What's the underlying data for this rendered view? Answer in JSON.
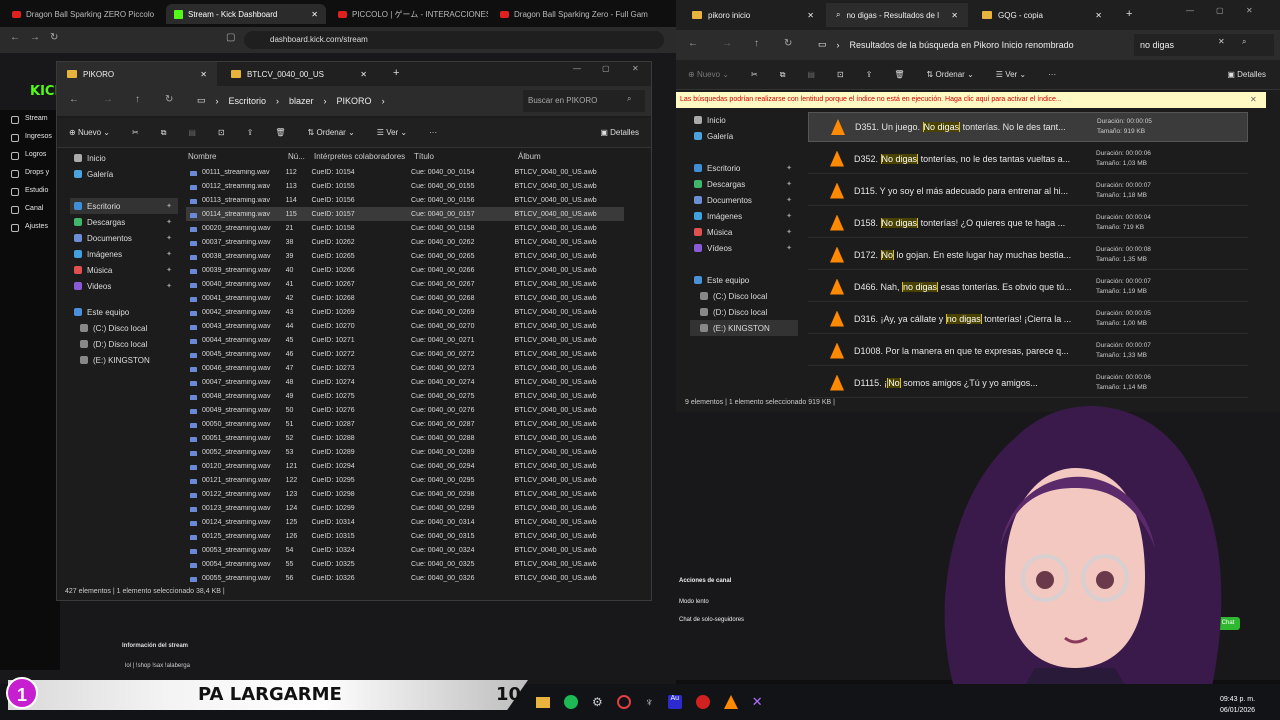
{
  "browser": {
    "tabs": [
      "Dragon Ball Sparking ZERO Piccolo",
      "Stream - Kick Dashboard",
      "PICCOLO | ゲーム - INTERACCIONES E",
      "Dragon Ball Sparking Zero - Full Gam"
    ],
    "url": "dashboard.kick.com/stream"
  },
  "kick": {
    "logo": "KICK",
    "sidebar": [
      "Stream",
      "Ingresos",
      "Logros",
      "Drops y",
      "Estudio",
      "Canal",
      "Ajustes"
    ],
    "stream_info": "Información del stream",
    "stream_title": "lol | !shop !sax !alaberga",
    "category": "Conversando",
    "channel_actions": "Acciones de canal",
    "slow_mode": "Modo lento",
    "followers_chat": "Chat de solo-seguidores",
    "chat_btn": "Chat"
  },
  "explorer1": {
    "tabs": [
      "PIKORO",
      "BTLCV_0040_00_US"
    ],
    "crumbs": [
      "Escritorio",
      "blazer",
      "PIKORO"
    ],
    "search": "Buscar en PIKORO",
    "toolbar": {
      "new": "Nuevo",
      "sort": "Ordenar",
      "view": "Ver",
      "details": "Detalles"
    },
    "nav": [
      "Inicio",
      "Galería",
      "Escritorio",
      "Descargas",
      "Documentos",
      "Imágenes",
      "Música",
      "Videos",
      "Este equipo",
      "(C:) Disco local",
      "(D:) Disco local",
      "(E:) KINGSTON"
    ],
    "columns": [
      "Nombre",
      "Nú...",
      "Intérpretes colaboradores",
      "Título",
      "Álbum"
    ],
    "rows": [
      [
        "00111_streaming.wav",
        "112",
        "CueID: 10154",
        "Cue: 0040_00_0154",
        "BTLCV_0040_00_US.awb"
      ],
      [
        "00112_streaming.wav",
        "113",
        "CueID: 10155",
        "Cue: 0040_00_0155",
        "BTLCV_0040_00_US.awb"
      ],
      [
        "00113_streaming.wav",
        "114",
        "CueID: 10156",
        "Cue: 0040_00_0156",
        "BTLCV_0040_00_US.awb"
      ],
      [
        "00114_streaming.wav",
        "115",
        "CueID: 10157",
        "Cue: 0040_00_0157",
        "BTLCV_0040_00_US.awb"
      ],
      [
        "00020_streaming.wav",
        "21",
        "CueID: 10158",
        "Cue: 0040_00_0158",
        "BTLCV_0040_00_US.awb"
      ],
      [
        "00037_streaming.wav",
        "38",
        "CueID: 10262",
        "Cue: 0040_00_0262",
        "BTLCV_0040_00_US.awb"
      ],
      [
        "00038_streaming.wav",
        "39",
        "CueID: 10265",
        "Cue: 0040_00_0265",
        "BTLCV_0040_00_US.awb"
      ],
      [
        "00039_streaming.wav",
        "40",
        "CueID: 10266",
        "Cue: 0040_00_0266",
        "BTLCV_0040_00_US.awb"
      ],
      [
        "00040_streaming.wav",
        "41",
        "CueID: 10267",
        "Cue: 0040_00_0267",
        "BTLCV_0040_00_US.awb"
      ],
      [
        "00041_streaming.wav",
        "42",
        "CueID: 10268",
        "Cue: 0040_00_0268",
        "BTLCV_0040_00_US.awb"
      ],
      [
        "00042_streaming.wav",
        "43",
        "CueID: 10269",
        "Cue: 0040_00_0269",
        "BTLCV_0040_00_US.awb"
      ],
      [
        "00043_streaming.wav",
        "44",
        "CueID: 10270",
        "Cue: 0040_00_0270",
        "BTLCV_0040_00_US.awb"
      ],
      [
        "00044_streaming.wav",
        "45",
        "CueID: 10271",
        "Cue: 0040_00_0271",
        "BTLCV_0040_00_US.awb"
      ],
      [
        "00045_streaming.wav",
        "46",
        "CueID: 10272",
        "Cue: 0040_00_0272",
        "BTLCV_0040_00_US.awb"
      ],
      [
        "00046_streaming.wav",
        "47",
        "CueID: 10273",
        "Cue: 0040_00_0273",
        "BTLCV_0040_00_US.awb"
      ],
      [
        "00047_streaming.wav",
        "48",
        "CueID: 10274",
        "Cue: 0040_00_0274",
        "BTLCV_0040_00_US.awb"
      ],
      [
        "00048_streaming.wav",
        "49",
        "CueID: 10275",
        "Cue: 0040_00_0275",
        "BTLCV_0040_00_US.awb"
      ],
      [
        "00049_streaming.wav",
        "50",
        "CueID: 10276",
        "Cue: 0040_00_0276",
        "BTLCV_0040_00_US.awb"
      ],
      [
        "00050_streaming.wav",
        "51",
        "CueID: 10287",
        "Cue: 0040_00_0287",
        "BTLCV_0040_00_US.awb"
      ],
      [
        "00051_streaming.wav",
        "52",
        "CueID: 10288",
        "Cue: 0040_00_0288",
        "BTLCV_0040_00_US.awb"
      ],
      [
        "00052_streaming.wav",
        "53",
        "CueID: 10289",
        "Cue: 0040_00_0289",
        "BTLCV_0040_00_US.awb"
      ],
      [
        "00120_streaming.wav",
        "121",
        "CueID: 10294",
        "Cue: 0040_00_0294",
        "BTLCV_0040_00_US.awb"
      ],
      [
        "00121_streaming.wav",
        "122",
        "CueID: 10295",
        "Cue: 0040_00_0295",
        "BTLCV_0040_00_US.awb"
      ],
      [
        "00122_streaming.wav",
        "123",
        "CueID: 10298",
        "Cue: 0040_00_0298",
        "BTLCV_0040_00_US.awb"
      ],
      [
        "00123_streaming.wav",
        "124",
        "CueID: 10299",
        "Cue: 0040_00_0299",
        "BTLCV_0040_00_US.awb"
      ],
      [
        "00124_streaming.wav",
        "125",
        "CueID: 10314",
        "Cue: 0040_00_0314",
        "BTLCV_0040_00_US.awb"
      ],
      [
        "00125_streaming.wav",
        "126",
        "CueID: 10315",
        "Cue: 0040_00_0315",
        "BTLCV_0040_00_US.awb"
      ],
      [
        "00053_streaming.wav",
        "54",
        "CueID: 10324",
        "Cue: 0040_00_0324",
        "BTLCV_0040_00_US.awb"
      ],
      [
        "00054_streaming.wav",
        "55",
        "CueID: 10325",
        "Cue: 0040_00_0325",
        "BTLCV_0040_00_US.awb"
      ],
      [
        "00055_streaming.wav",
        "56",
        "CueID: 10326",
        "Cue: 0040_00_0326",
        "BTLCV_0040_00_US.awb"
      ]
    ],
    "status": "427 elementos   |   1 elemento seleccionado  38,4 KB  |"
  },
  "explorer2": {
    "tabs": [
      "pikoro inicio",
      "no digas - Resultados de l",
      "GQG - copia"
    ],
    "crumb": "Resultados de la búsqueda en Pikoro Inicio renombrado",
    "search": "no digas",
    "toolbar": {
      "new": "Nuevo",
      "sort": "Ordenar",
      "view": "Ver",
      "details": "Detalles"
    },
    "warning": "Las búsquedas podrían realizarse con lentitud porque el índice no está en ejecución. Haga clic aquí para activar el índice...",
    "nav": [
      "Inicio",
      "Galería",
      "Escritorio",
      "Descargas",
      "Documentos",
      "Imágenes",
      "Música",
      "Vídeos",
      "Este equipo",
      "(C:) Disco local",
      "(D:) Disco local",
      "(E:) KINGSTON"
    ],
    "results": [
      {
        "pre": "D351. Un juego. ",
        "hl": "No digas",
        "post": " tonterías. No le des tant...",
        "dur": "Duración: 00:00:05",
        "size": "Tamaño: 919 KB"
      },
      {
        "pre": "D352. ",
        "hl": "No digas",
        "post": " tonterías, no le des tantas vueltas a...",
        "dur": "Duración: 00:00:06",
        "size": "Tamaño: 1,03 MB"
      },
      {
        "pre": "D115. Y yo soy el más adecuado para entrenar al hi...",
        "hl": "",
        "post": "",
        "dur": "Duración: 00:00:07",
        "size": "Tamaño: 1,18 MB"
      },
      {
        "pre": "D158. ",
        "hl": "No digas",
        "post": " tonterías! ¿O quieres que te haga ...",
        "dur": "Duración: 00:00:04",
        "size": "Tamaño: 719 KB"
      },
      {
        "pre": "D172. ",
        "hl": "No",
        "post": " lo gojan. En este lugar hay muchas bestia...",
        "dur": "Duración: 00:00:08",
        "size": "Tamaño: 1,35 MB"
      },
      {
        "pre": "D466. Nah, ",
        "hl": "no digas",
        "post": " esas tonterías. Es obvio que tú...",
        "dur": "Duración: 00:00:07",
        "size": "Tamaño: 1,19 MB"
      },
      {
        "pre": "D316. ¡Ay, ya cállate y ",
        "hl": "no digas",
        "post": " tonterías! ¡Cierra la ...",
        "dur": "Duración: 00:00:05",
        "size": "Tamaño: 1,00 MB"
      },
      {
        "pre": "D1008. Por la manera en que te expresas, parece q...",
        "hl": "",
        "post": "",
        "dur": "Duración: 00:00:07",
        "size": "Tamaño: 1,33 MB"
      },
      {
        "pre": "D1115. ¡",
        "hl": "No",
        "post": " somos amigos ¿Tú y yo amigos...",
        "dur": "Duración: 00:00:06",
        "size": "Tamaño: 1,14 MB"
      }
    ],
    "status": "9 elementos   |   1 elemento seleccionado  919 KB   |"
  },
  "overlay": {
    "badge": "1",
    "caption": "PA LARGARME",
    "count": "10",
    "time": "09:43 p. m.",
    "date": "06/01/2026"
  }
}
